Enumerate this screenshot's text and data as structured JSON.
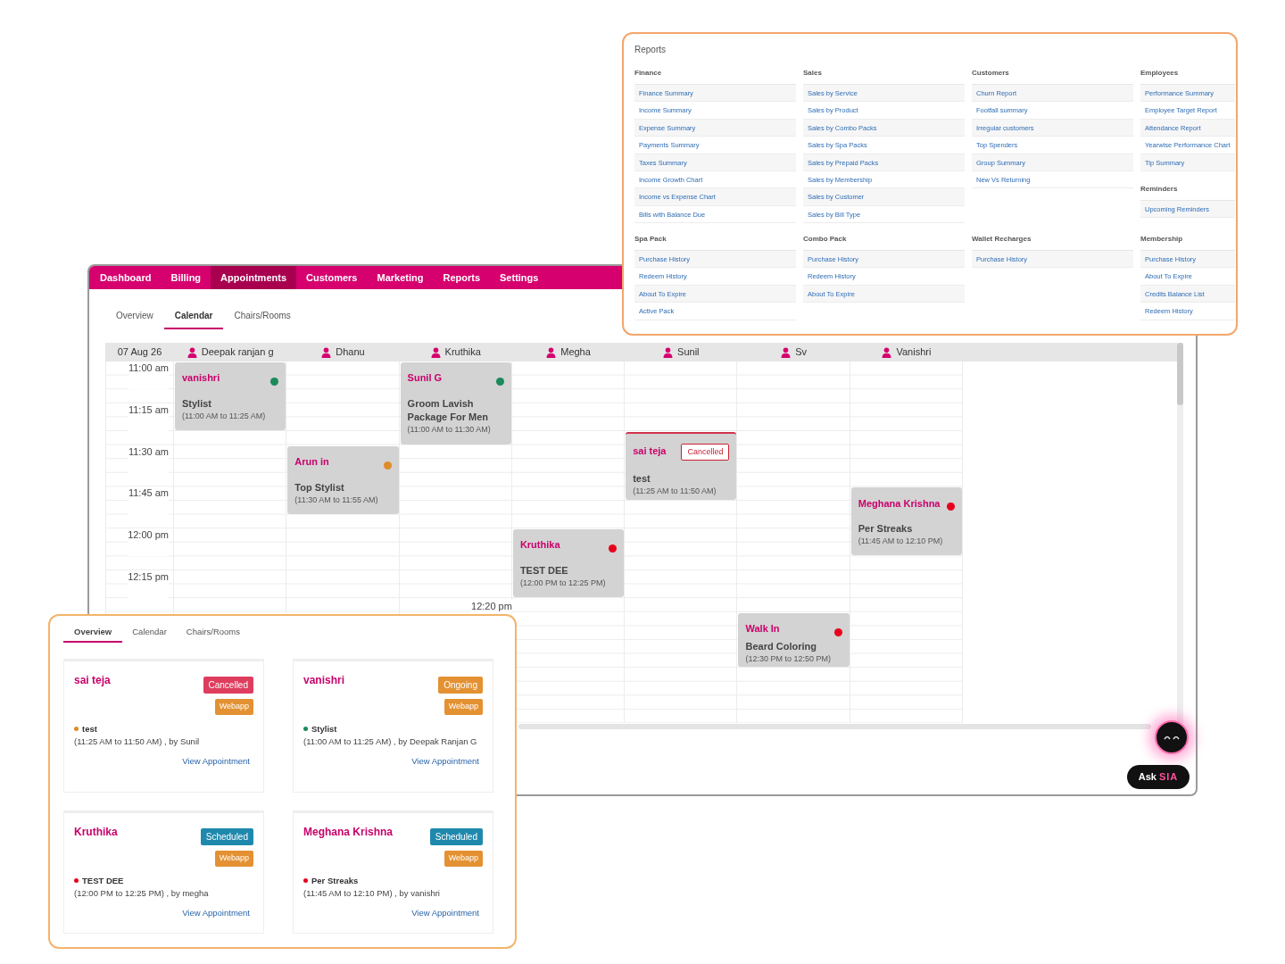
{
  "app": {
    "nav": [
      {
        "label": "Dashboard",
        "selected": false
      },
      {
        "label": "Billing",
        "selected": false
      },
      {
        "label": "Appointments",
        "selected": true
      },
      {
        "label": "Customers",
        "selected": false
      },
      {
        "label": "Marketing",
        "selected": false
      },
      {
        "label": "Reports",
        "selected": false
      },
      {
        "label": "Settings",
        "selected": false
      }
    ],
    "subtabs": [
      {
        "label": "Overview",
        "selected": false
      },
      {
        "label": "Calendar",
        "selected": true
      },
      {
        "label": "Chairs/Rooms",
        "selected": false
      }
    ],
    "calendar": {
      "date": "07 Aug 26",
      "now_label": "12:20 pm",
      "times": [
        {
          "label": "11:00 am"
        },
        {
          "label": "11:15 am"
        },
        {
          "label": "11:30 am"
        },
        {
          "label": "11:45 am"
        },
        {
          "label": "12:00 pm"
        },
        {
          "label": "12:15 pm"
        }
      ],
      "staff": [
        {
          "name": "Deepak ranjan g",
          "events": [
            {
              "kind": "booked",
              "name": "vanishri",
              "color": "#1a8a5a",
              "service": "Stylist",
              "time": "(11:00 AM to 11:25 AM)"
            }
          ]
        },
        {
          "name": "Dhanu",
          "events": [
            {
              "kind": "booked",
              "name": "Arun in",
              "color": "#e08a2a",
              "service": "Top Stylist",
              "time": "(11:30 AM to 11:55 AM)"
            }
          ]
        },
        {
          "name": "Kruthika",
          "events": [
            {
              "kind": "booked",
              "name": "Sunil G",
              "color": "#1a8a5a",
              "service": "Groom Lavish Package For Men",
              "time": "(11:00 AM to 11:30 AM)"
            }
          ]
        },
        {
          "name": "Megha",
          "events": [
            {
              "kind": "booked",
              "name": "Kruthika",
              "color": "#e8001c",
              "service": "TEST DEE",
              "time": "(12:00 PM to 12:25 PM)"
            }
          ]
        },
        {
          "name": "Sunil",
          "events": [
            {
              "kind": "cancelled",
              "name": "sai teja",
              "badge": "Cancelled",
              "service": "test",
              "time": "(11:25 AM to 11:50 AM)"
            }
          ]
        },
        {
          "name": "Sv",
          "events": [
            {
              "kind": "booked",
              "name": "Walk In",
              "color": "#e8001c",
              "service": "Beard Coloring",
              "time": "(12:30 PM to 12:50 PM)"
            }
          ]
        },
        {
          "name": "Vanishri",
          "events": [
            {
              "kind": "booked",
              "name": "Meghana Krishna",
              "color": "#e8001c",
              "service": "Per Streaks",
              "time": "(11:45 AM to 12:10 PM)"
            }
          ]
        }
      ]
    },
    "assistant": {
      "label": "Ask",
      "brand": "SIA"
    }
  },
  "reports": {
    "title": "Reports",
    "rows": [
      {
        "columns": [
          [
            {
              "title": "Finance",
              "items": [
                "Finance Summary",
                "Income Summary",
                "Expense Summary",
                "Payments Summary",
                "Taxes Summary",
                "Income Growth Chart",
                "Income vs Expense Chart",
                "Bills with Balance Due"
              ]
            }
          ],
          [
            {
              "title": "Sales",
              "items": [
                "Sales by Service",
                "Sales by Product",
                "Sales by Combo Packs",
                "Sales by Spa Packs",
                "Sales by Prepaid Packs",
                "Sales by Membership",
                "Sales by Customer",
                "Sales by Bill Type"
              ]
            }
          ],
          [
            {
              "title": "Customers",
              "items": [
                "Churn Report",
                "Footfall summary",
                "Irregular customers",
                "Top Spenders",
                "Group Summary",
                "New Vs Returning"
              ]
            }
          ],
          [
            {
              "title": "Employees",
              "items": [
                "Performance Summary",
                "Employee Target Report",
                "Attendance Report",
                "Yearwise Performance Chart",
                "Tip Summary"
              ]
            },
            {
              "title": "Reminders",
              "items": [
                "Upcoming Reminders"
              ]
            }
          ]
        ]
      },
      {
        "columns": [
          [
            {
              "title": "Spa Pack",
              "items": [
                "Purchase History",
                "Redeem History",
                "About To Expire",
                "Active Pack"
              ]
            }
          ],
          [
            {
              "title": "Combo Pack",
              "items": [
                "Purchase History",
                "Redeem History",
                "About To Expire"
              ]
            }
          ],
          [
            {
              "title": "Wallet Recharges",
              "items": [
                "Purchase History"
              ]
            }
          ],
          [
            {
              "title": "Membership",
              "items": [
                "Purchase History",
                "About To Expire",
                "Credits Balance List",
                "Redeem History"
              ]
            }
          ]
        ]
      }
    ]
  },
  "overview": {
    "tabs": [
      {
        "label": "Overview",
        "selected": true
      },
      {
        "label": "Calendar",
        "selected": false
      },
      {
        "label": "Chairs/Rooms",
        "selected": false
      }
    ],
    "cards": [
      {
        "name": "sai teja",
        "status": "Cancelled",
        "kind": "cancelled",
        "source": "Webapp",
        "service": "test",
        "color": "#e08a2a",
        "time": "(11:25 AM to 11:50 AM) , by Sunil",
        "link": "View Appointment"
      },
      {
        "name": "vanishri",
        "status": "Ongoing",
        "kind": "ongoing",
        "source": "Webapp",
        "service": "Stylist",
        "color": "#1a8a5a",
        "time": "(11:00 AM to 11:25 AM) , by Deepak Ranjan G",
        "link": "View Appointment"
      },
      {
        "name": "Kruthika",
        "status": "Scheduled",
        "kind": "scheduled",
        "source": "Webapp",
        "service": "TEST DEE",
        "color": "#e8001c",
        "time": "(12:00 PM to 12:25 PM) , by megha",
        "link": "View Appointment"
      },
      {
        "name": "Meghana Krishna",
        "status": "Scheduled",
        "kind": "scheduled",
        "source": "Webapp",
        "service": "Per Streaks",
        "color": "#e8001c",
        "time": "(11:45 AM to 12:10 PM) , by vanishri",
        "link": "View Appointment"
      }
    ]
  }
}
